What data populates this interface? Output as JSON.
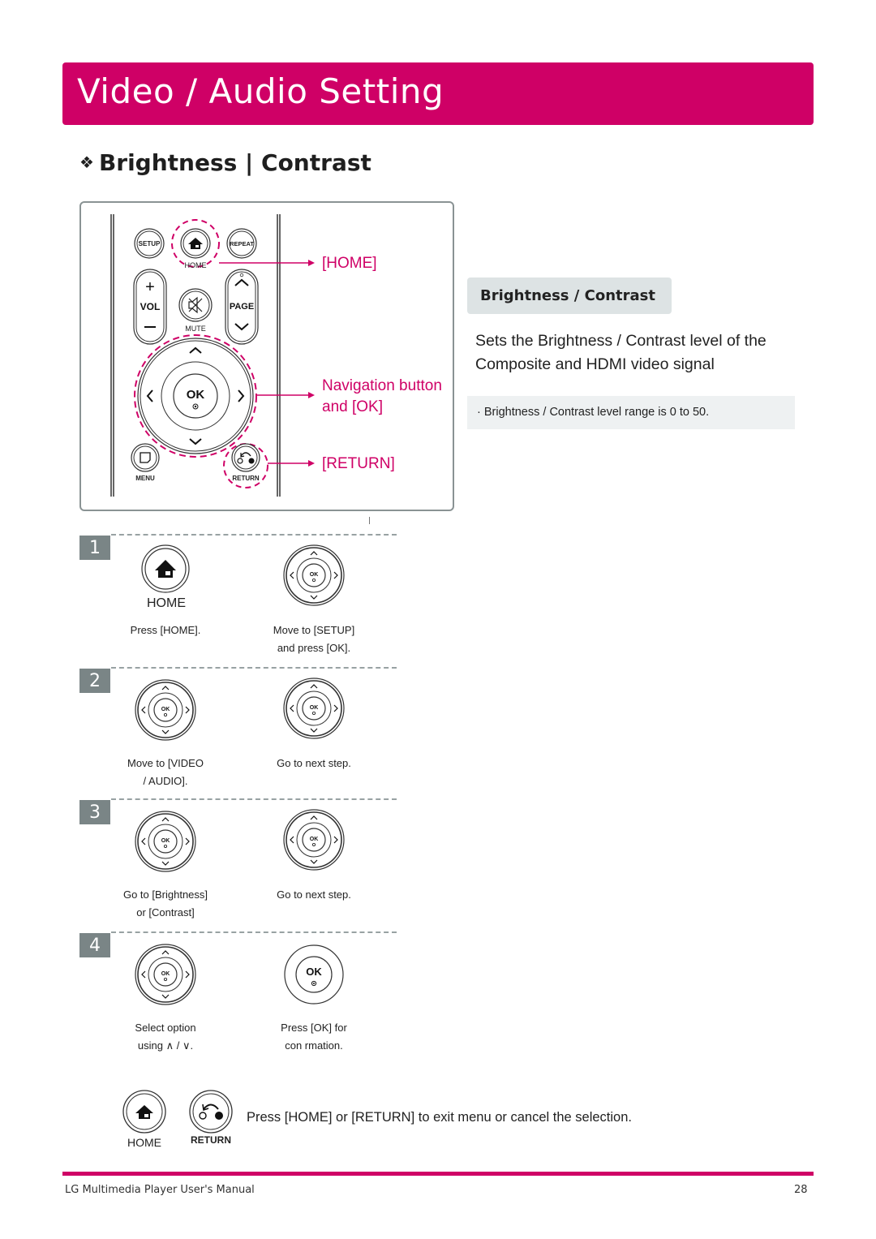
{
  "page": {
    "title": "Video / Audio Setting",
    "accent_color": "#cf0066",
    "section_heading": "Brightness | Contrast",
    "section_bullet_icon": "four-diamond-bullet"
  },
  "remote": {
    "buttons": {
      "setup": "SETUP",
      "home": "HOME",
      "repeat": "REPEAT",
      "vol": "VOL",
      "mute": "MUTE",
      "page": "PAGE",
      "ok": "OK",
      "menu": "MENU",
      "return": "RETURN"
    },
    "callouts": {
      "home": "[HOME]",
      "nav_line1": "Navigation button",
      "nav_line2": "and [OK]",
      "return": "[RETURN]"
    }
  },
  "info": {
    "subheading": "Brightness / Contrast",
    "description": "Sets the Brightness / Contrast level of the Composite and HDMI video signal",
    "note": "· Brightness / Contrast level range is 0 to 50."
  },
  "steps": [
    {
      "number": "1",
      "left_icon": "home-button",
      "left_icon_label": "HOME",
      "left_caption": [
        "Press [HOME].",
        ""
      ],
      "right_icon": "navigation-ok-pad",
      "right_caption": [
        "Move to [SETUP]",
        "and press [OK]."
      ]
    },
    {
      "number": "2",
      "left_icon": "navigation-ok-pad",
      "left_caption": [
        "Move to [VIDEO",
        "/ AUDIO]."
      ],
      "right_icon": "navigation-ok-pad",
      "right_caption": [
        "Go to next step.",
        ""
      ]
    },
    {
      "number": "3",
      "left_icon": "navigation-ok-pad",
      "left_caption": [
        "Go to [Brightness]",
        "or [Contrast]"
      ],
      "right_icon": "navigation-ok-pad",
      "right_caption": [
        "Go to next step.",
        ""
      ]
    },
    {
      "number": "4",
      "left_icon": "navigation-ok-pad",
      "left_caption": [
        "Select option",
        "using ∧ / ∨."
      ],
      "right_icon": "ok-button",
      "right_caption": [
        "Press [OK] for",
        "con rmation."
      ]
    }
  ],
  "exit_hint": {
    "home_label": "HOME",
    "return_label": "RETURN",
    "text": "Press [HOME] or [RETURN] to exit menu or cancel the selection."
  },
  "footer": {
    "manual_title": "LG Multimedia Player User's Manual",
    "page_number": "28"
  }
}
